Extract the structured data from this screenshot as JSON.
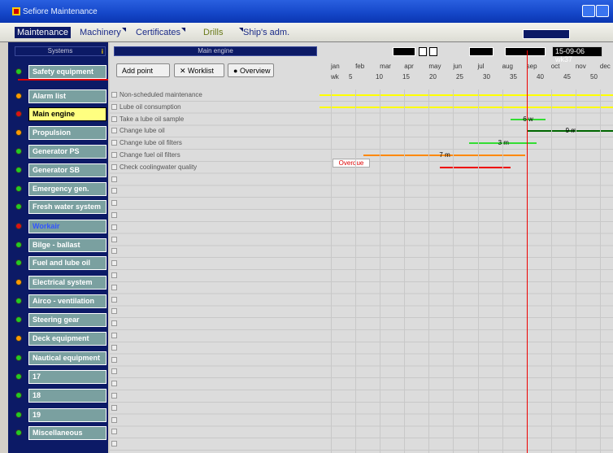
{
  "window": {
    "title": "Sefiore Maintenance"
  },
  "nav": {
    "tabs": [
      {
        "label": "Maintenance",
        "active": true
      },
      {
        "label": "Machinery"
      },
      {
        "label": "Certificates"
      },
      {
        "label": "Drills"
      },
      {
        "label": "Ship's adm."
      }
    ]
  },
  "left": {
    "header": "Systems",
    "info_icon": "i",
    "systems": [
      {
        "label": "Safety equipment",
        "status": "green"
      },
      {
        "label": "Alarm list",
        "status": "orange"
      },
      {
        "label": "Main engine",
        "status": "red",
        "selected": true
      },
      {
        "label": "Propulsion",
        "status": "orange"
      },
      {
        "label": "Generator PS",
        "status": "green"
      },
      {
        "label": "Generator SB",
        "status": "green"
      },
      {
        "label": "Emergency gen.",
        "status": "green"
      },
      {
        "label": "Fresh water system",
        "status": "green"
      },
      {
        "label": "Workair",
        "status": "red",
        "highlight": true
      },
      {
        "label": "Bilge - ballast",
        "status": "green"
      },
      {
        "label": "Fuel and lube oil",
        "status": "green"
      },
      {
        "label": "Electrical system",
        "status": "orange"
      },
      {
        "label": "Airco - ventilation",
        "status": "green"
      },
      {
        "label": "Steering gear",
        "status": "green"
      },
      {
        "label": "Deck equipment",
        "status": "orange"
      },
      {
        "label": "Nautical equipment",
        "status": "green"
      },
      {
        "label": "17",
        "status": "green"
      },
      {
        "label": "18",
        "status": "green"
      },
      {
        "label": "19",
        "status": "green"
      },
      {
        "label": "Miscellaneous",
        "status": "green"
      }
    ]
  },
  "toolbar": {
    "header": "Main engine",
    "add_point": "Add point",
    "worklist": "Worklist",
    "overview": "Overview",
    "date": "15-09-06 wk37"
  },
  "timeline": {
    "months": [
      "jan",
      "feb",
      "mar",
      "apr",
      "may",
      "jun",
      "jul",
      "aug",
      "sep",
      "oct",
      "nov",
      "dec"
    ],
    "weeks": [
      "wk",
      "5",
      "10",
      "15",
      "20",
      "25",
      "30",
      "35",
      "40",
      "45",
      "50"
    ],
    "tasks": [
      {
        "name": "Non-scheduled maintenance",
        "color": "#ffff00",
        "start": 0.0,
        "end": 1.0,
        "label": ""
      },
      {
        "name": "Lube oil consumption",
        "color": "#ffff00",
        "start": 0.0,
        "end": 1.0,
        "label": ""
      },
      {
        "name": "Take a lube oil sample",
        "color": "#33dd33",
        "start": 0.65,
        "end": 0.77,
        "label": "6 w"
      },
      {
        "name": "Change lube oil",
        "color": "#006600",
        "start": 0.71,
        "end": 1.0,
        "label": "9 m"
      },
      {
        "name": "Change lube oil filters",
        "color": "#33dd33",
        "start": 0.51,
        "end": 0.74,
        "label": "3 m"
      },
      {
        "name": "Change fuel oil filters",
        "color": "#ff8800",
        "start": 0.15,
        "end": 0.7,
        "label": "7 m"
      },
      {
        "name": "Check coolingwater quality",
        "color": "#ee0000",
        "start": 0.41,
        "end": 0.65,
        "label": ""
      }
    ],
    "overdue_label": "Overdue"
  },
  "colors": {
    "navy": "#0c1a66",
    "teal": "#7aa0a0",
    "today": "#ee0000"
  }
}
